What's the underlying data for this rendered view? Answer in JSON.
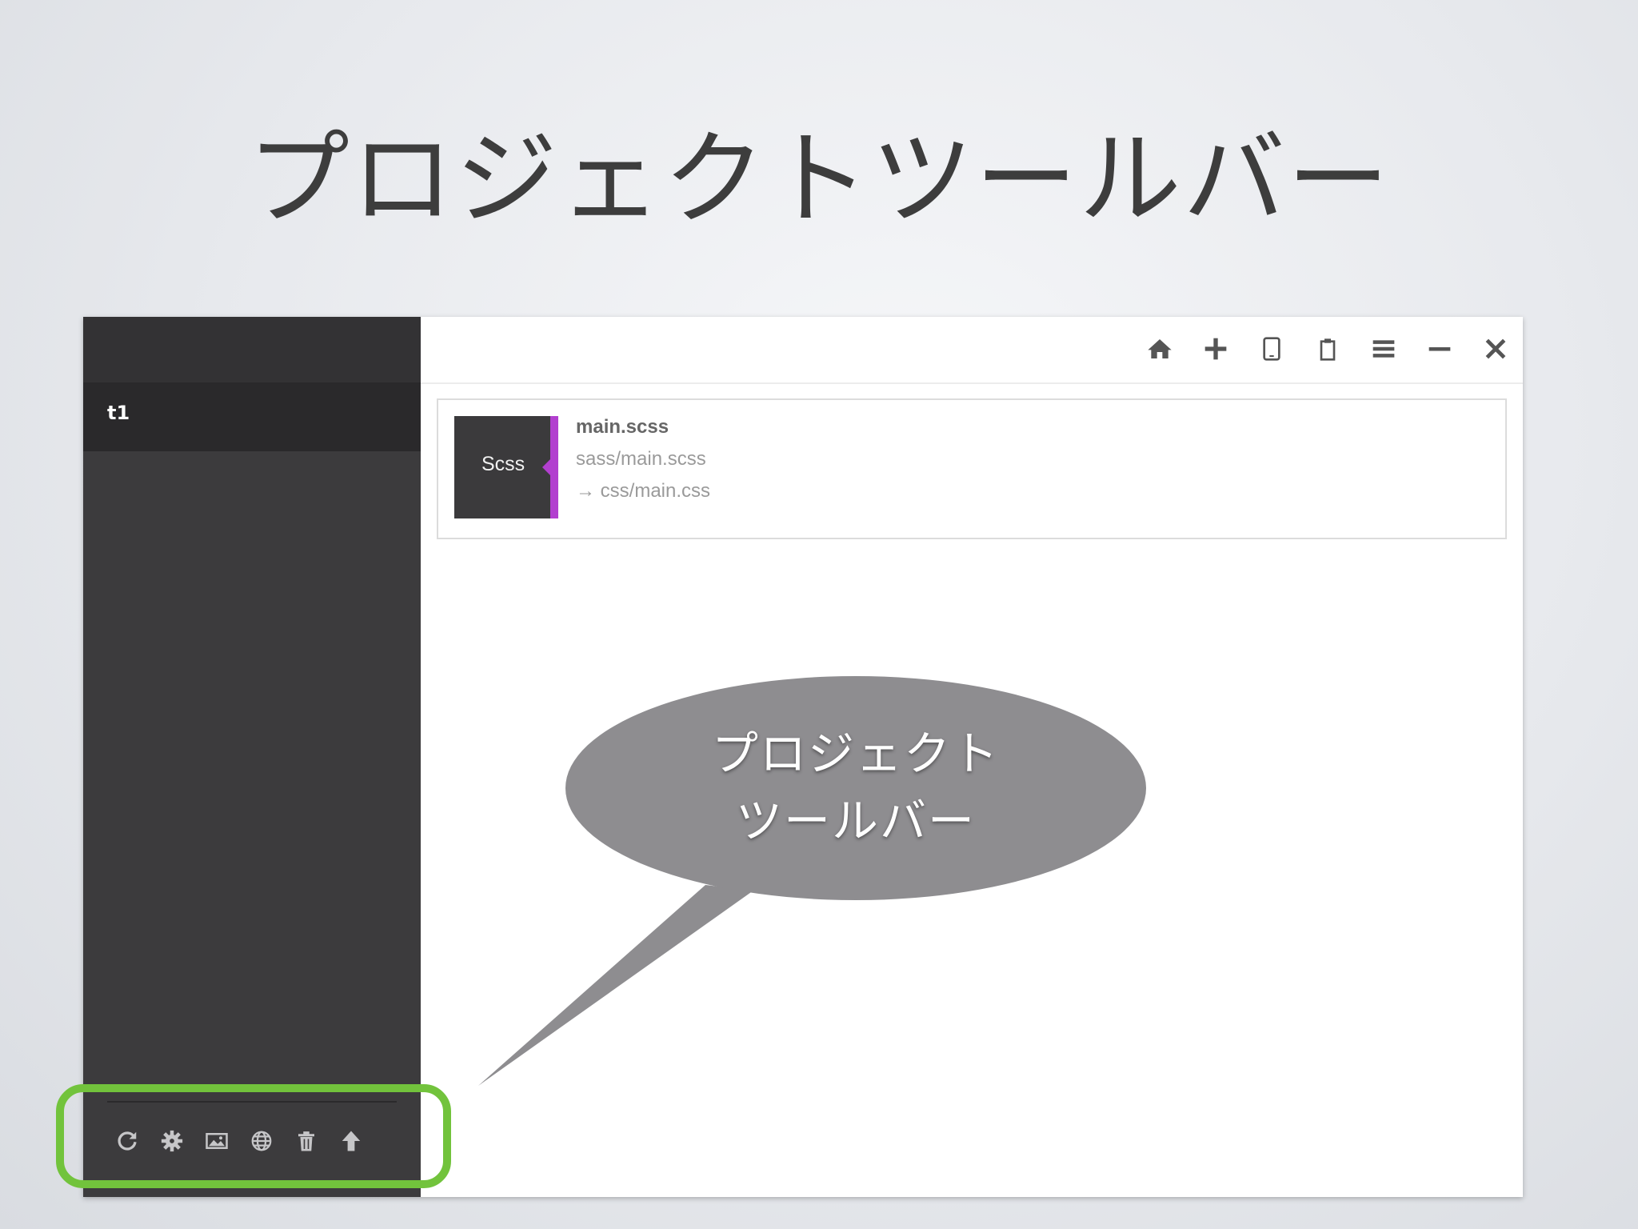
{
  "slide": {
    "title": "プロジェクトツールバー"
  },
  "sidebar": {
    "project_name": "t1",
    "toolbar": {
      "items": [
        {
          "icon": "refresh-icon"
        },
        {
          "icon": "gear-icon"
        },
        {
          "icon": "image-icon"
        },
        {
          "icon": "globe-icon"
        },
        {
          "icon": "trash-icon"
        },
        {
          "icon": "upload-arrow-icon"
        }
      ]
    }
  },
  "topbar": {
    "icons": [
      "home-icon",
      "plus-icon",
      "tablet-icon",
      "clipboard-icon",
      "menu-icon",
      "minimize-icon",
      "close-icon"
    ]
  },
  "file": {
    "badge": "Scss",
    "name": "main.scss",
    "source": "sass/main.scss",
    "output": "→ css/main.css"
  },
  "callout": {
    "line1": "プロジェクト",
    "line2": "ツールバー"
  },
  "colors": {
    "sidebar": "#3c3b3d",
    "highlight": "#72c33c",
    "badge_accent": "#b23fcf",
    "callout": "#8e8d90"
  }
}
